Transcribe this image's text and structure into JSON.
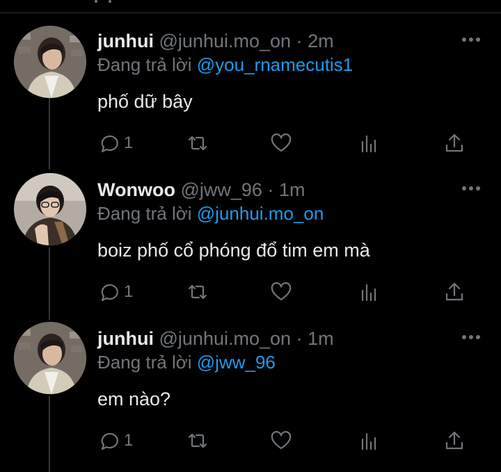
{
  "thread": [
    {
      "name": "junhui",
      "handle": "@junhui.mo_on",
      "separator": "·",
      "time": "2m",
      "reply_prefix": "Đang trả lời ",
      "reply_to": "@you_rnamecutis1",
      "text": "phố dữ bây",
      "reply_count": "1",
      "avatar": "junhui-avatar"
    },
    {
      "name": "Wonwoo",
      "handle": "@jww_96",
      "separator": "·",
      "time": "1m",
      "reply_prefix": "Đang trả lời ",
      "reply_to": "@junhui.mo_on",
      "text": "boiz phố cổ phóng đổ tim em mà",
      "reply_count": "1",
      "avatar": "wonwoo-avatar"
    },
    {
      "name": "junhui",
      "handle": "@junhui.mo_on",
      "separator": "·",
      "time": "1m",
      "reply_prefix": "Đang trả lời ",
      "reply_to": "@jww_96",
      "text": "em nào?",
      "reply_count": "1",
      "avatar": "junhui-avatar"
    }
  ],
  "icons": [
    "reply-icon",
    "retweet-icon",
    "like-icon",
    "views-icon",
    "share-icon",
    "more-options-icon"
  ],
  "colors": {
    "background": "#000000",
    "text": "#e7e9ea",
    "muted": "#71767b",
    "mention": "#1d9bf0"
  }
}
